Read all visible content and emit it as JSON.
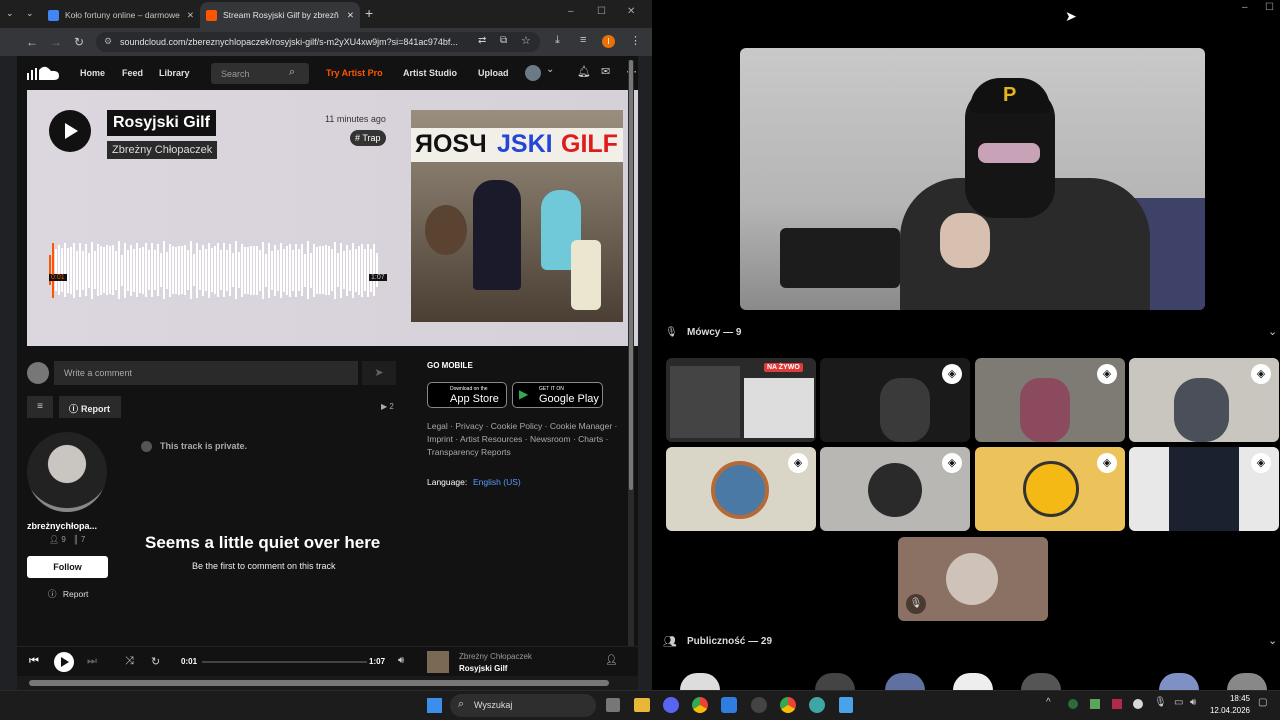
{
  "browser": {
    "tabs": [
      {
        "label": "Koło fortuny online – darmowe"
      },
      {
        "label": "Stream Rosyjski Gilf by zbrezň"
      }
    ],
    "url": "soundcloud.com/zbereznychlopaczek/rosyjski-gilf/s-m2yXU4xw9jm?si=841ac974bf..."
  },
  "soundcloud": {
    "nav": {
      "home": "Home",
      "feed": "Feed",
      "library": "Library",
      "search_placeholder": "Search",
      "try_pro": "Try Artist Pro",
      "artist_studio": "Artist Studio",
      "upload": "Upload"
    },
    "track": {
      "title": "Rosyjski Gilf",
      "artist": "Zbreżny Chłopaczek",
      "posted": "11 minutes ago",
      "tag": "# Trap",
      "time_start": "0:01",
      "time_end": "1:07",
      "art_text_1": "ЯOSЧ",
      "art_text_2": "JSKI",
      "art_text_3": "GILF"
    },
    "comment_placeholder": "Write a comment",
    "report": "Report",
    "plays": "2",
    "private_note": "This track is private.",
    "user": {
      "name": "zbreżnychłopa...",
      "followers": "9",
      "tracks": "7",
      "follow": "Follow",
      "report": "Report"
    },
    "empty": {
      "title": "Seems a little quiet over here",
      "subtitle": "Be the first to comment on this track"
    },
    "go_mobile": "GO MOBILE",
    "app_store": {
      "small": "Download on the",
      "big": "App Store"
    },
    "google_play": {
      "small": "GET IT ON",
      "big": "Google Play"
    },
    "footer_links": "Legal · Privacy · Cookie Policy · Cookie Manager · Imprint · Artist Resources · Newsroom · Charts · Transparency Reports",
    "language_label": "Language:",
    "language": "English (US)",
    "player": {
      "elapsed": "0:01",
      "total": "1:07",
      "artist": "Zbreżny Chłopaczek",
      "title": "Rosyjski Gilf"
    }
  },
  "discord": {
    "speakers_label": "Mówcy — 9",
    "audience_label": "Publiczność — 29",
    "live_badge": "NA ŻYWO",
    "cap_letter": "P"
  },
  "taskbar": {
    "search": "Wyszukaj",
    "time": "18:45",
    "date": "12.04.2026"
  },
  "colors": {
    "accent_orange": "#ff5500",
    "discord_bg": "#000000",
    "sc_bg": "#121212"
  }
}
